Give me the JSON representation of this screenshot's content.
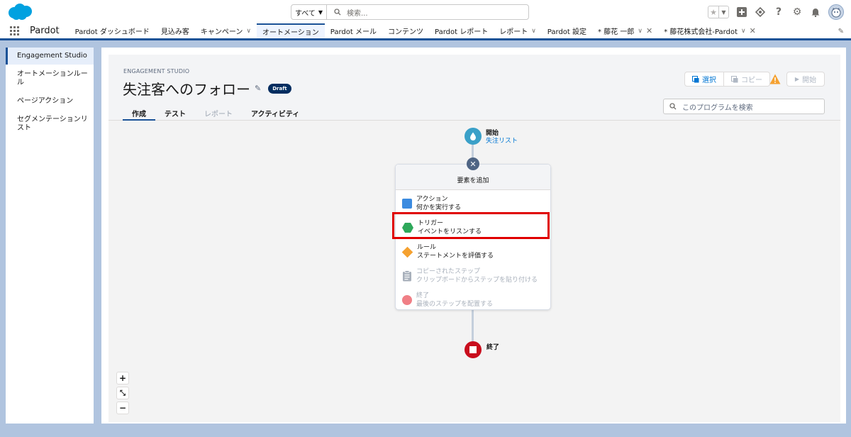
{
  "header": {
    "search_scope": "すべて",
    "search_placeholder": "検索..."
  },
  "nav": {
    "app_name": "Pardot",
    "items": [
      {
        "label": "Pardot ダッシュボード"
      },
      {
        "label": "見込み客"
      },
      {
        "label": "キャンペーン"
      },
      {
        "label": "オートメーション"
      },
      {
        "label": "Pardot メール"
      },
      {
        "label": "コンテンツ"
      },
      {
        "label": "Pardot レポート"
      },
      {
        "label": "レポート"
      },
      {
        "label": "Pardot 設定"
      },
      {
        "label": "* 藤花 一郎"
      },
      {
        "label": "* 藤花株式会社-Pardot"
      }
    ]
  },
  "sidebar": {
    "items": [
      {
        "label": "Engagement Studio"
      },
      {
        "label": "オートメーションルール"
      },
      {
        "label": "ページアクション"
      },
      {
        "label": "セグメンテーションリスト"
      }
    ]
  },
  "studio": {
    "eyebrow": "ENGAGEMENT STUDIO",
    "title": "失注客へのフォロー",
    "badge": "Draft",
    "tabs": [
      {
        "label": "作成"
      },
      {
        "label": "テスト"
      },
      {
        "label": "レポート"
      },
      {
        "label": "アクティビティ"
      }
    ],
    "btn_select": "選択",
    "btn_copy": "コピー",
    "btn_start": "開始",
    "search_placeholder": "このプログラムを検索"
  },
  "canvas": {
    "start_label": "開始",
    "start_sub": "失注リスト",
    "popup_title": "要素を追加",
    "options": [
      {
        "title": "アクション",
        "desc": "何かを実行する"
      },
      {
        "title": "トリガー",
        "desc": "イベントをリスンする"
      },
      {
        "title": "ルール",
        "desc": "ステートメントを評価する"
      },
      {
        "title": "コピーされたステップ",
        "desc": "クリップボードからステップを貼り付ける"
      },
      {
        "title": "終了",
        "desc": "最後のステップを配置する"
      }
    ],
    "end_label": "終了"
  },
  "zoom": {
    "plus": "+",
    "fit": "⤡",
    "minus": "−"
  },
  "colors": {
    "brand": "#1b5297",
    "start": "#3aa0c8",
    "end": "#c90d1d",
    "highlight": "#e00000"
  }
}
